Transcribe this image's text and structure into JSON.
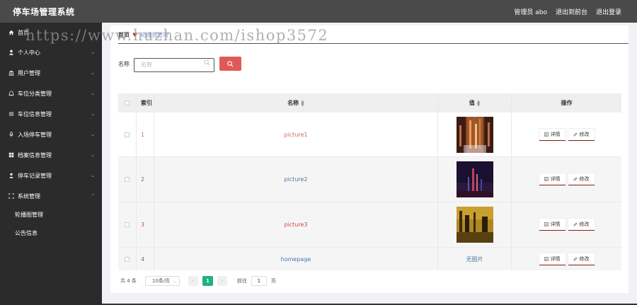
{
  "header": {
    "title": "停车场管理系统",
    "admin": "管理员 abo",
    "back_to_front": "退出到前台",
    "logout": "退出登录"
  },
  "sidebar": {
    "items": [
      {
        "label": "首页",
        "icon": "home-icon",
        "has_chevron": false
      },
      {
        "label": "个人中心",
        "icon": "user-icon",
        "has_chevron": true
      },
      {
        "label": "用户管理",
        "icon": "bank-icon",
        "has_chevron": true
      },
      {
        "label": "车位分类管理",
        "icon": "bell-icon",
        "has_chevron": true
      },
      {
        "label": "车位信息管理",
        "icon": "list-icon",
        "has_chevron": true
      },
      {
        "label": "入场停车管理",
        "icon": "mic-icon",
        "has_chevron": true
      },
      {
        "label": "档案信息管理",
        "icon": "grid-icon",
        "has_chevron": true
      },
      {
        "label": "停车记录管理",
        "icon": "person-icon",
        "has_chevron": true
      },
      {
        "label": "系统管理",
        "icon": "frame-icon",
        "has_chevron": true,
        "expanded": true
      }
    ],
    "subitems": [
      {
        "label": "轮播图管理"
      },
      {
        "label": "公告信息"
      }
    ],
    "chevron_down": "⌄",
    "chevron_up": "⌃"
  },
  "breadcrumb": {
    "home": "首页",
    "current": "轮播图管理"
  },
  "watermark": "https://www.huzhan.com/ishop3572",
  "search": {
    "label": "名称",
    "placeholder": "名称"
  },
  "table": {
    "headers": {
      "index": "索引",
      "name": "名称",
      "value": "值",
      "actions": "操作"
    },
    "rows": [
      {
        "index": "1",
        "name": "picture1",
        "value": "image",
        "thumb": "city"
      },
      {
        "index": "2",
        "name": "picture2",
        "value": "image",
        "thumb": "night"
      },
      {
        "index": "3",
        "name": "picture3",
        "value": "image",
        "thumb": "dusk"
      },
      {
        "index": "4",
        "name": "homepage",
        "value": "无图片",
        "thumb": ""
      }
    ],
    "detail_label": "详情",
    "edit_label": "修改"
  },
  "pager": {
    "total": "共 4 条",
    "page_size": "10条/页",
    "current_page": "1",
    "prev": "‹",
    "next": "›",
    "goto_label": "前往",
    "goto_value": "1",
    "page_suffix": "页"
  },
  "colors": {
    "header_bg": "#4a4a4a",
    "sidebar_bg": "#2b2b2b",
    "search_btn": "#e05a5a",
    "pager_active": "#20b080"
  }
}
